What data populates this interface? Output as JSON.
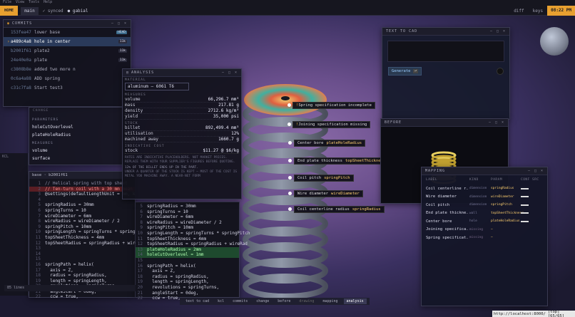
{
  "topbar": {
    "brand": "HOME",
    "branch": "main",
    "synced": "✓ synced",
    "user": "● gabial",
    "menu": [
      "File",
      "View",
      "Tools",
      "Help"
    ],
    "diff": "diff",
    "keys": "keys",
    "clock": "08:22 PM"
  },
  "commits": {
    "title": "COMMITS",
    "items": [
      {
        "hash": "153fea47",
        "msg": "lower base",
        "badge": "HEAD",
        "active": false
      },
      {
        "hash": "a489c4a8",
        "msg": "hole in center",
        "badge": "11k",
        "active": true
      },
      {
        "hash": "b2001f61",
        "msg": "plate2",
        "badge": "11k",
        "active": false
      },
      {
        "hash": "24e40e0a",
        "msg": "plate",
        "badge": "11k",
        "active": false
      },
      {
        "hash": "c3808b8e",
        "msg": "added two more n",
        "badge": "",
        "active": false
      },
      {
        "hash": "0c6a4a88",
        "msg": "ADD spring",
        "badge": "",
        "active": false
      },
      {
        "hash": "c31c7fa8",
        "msg": "Start test3",
        "badge": "",
        "active": false
      }
    ]
  },
  "params": {
    "change_label": "CHANGE",
    "parameters_label": "PARAMETERS",
    "parameters": [
      "holeCutOverlevel",
      "plateHoleRadius"
    ],
    "measures_label": "MEASURES",
    "measures": [
      "volume",
      "surface"
    ]
  },
  "analysis": {
    "title": "ANALYSIS",
    "material_label": "MATERIAL",
    "material": "aluminum — 6061 T6",
    "measures_label": "MEASURES",
    "measures": [
      {
        "k": "volume",
        "v": "66,296.7 mm³"
      },
      {
        "k": "mass",
        "v": "217.81 g"
      },
      {
        "k": "density",
        "v": "2712.6 kg/m³"
      },
      {
        "k": "yield",
        "v": "35,000 psi"
      }
    ],
    "stock_label": "STOCK",
    "stock": [
      {
        "k": "billet",
        "v": "892,499.4 mm³"
      },
      {
        "k": "utilisation",
        "v": "12%"
      },
      {
        "k": "machined away",
        "v": "1660.7 g"
      }
    ],
    "cost_label": "INDICATIVE COST",
    "cost": {
      "k": "stock",
      "v": "$11.27 @ $6/kg"
    },
    "note": "RATES ARE INDICATIVE PLACEHOLDERS. NOT MARKET PRICES. REPLACE THEM WITH YOUR SUPPLIER'S FIGURES BEFORE QUOTING.",
    "note2": "12% OF THE BILLET ENDS UP IN THE PART.",
    "note3": "UNDER A QUARTER OF THE STOCK IS KEPT — MOST OF THE COST IS METAL YOU MACHINE AWAY. A NEAR-NET FORM"
  },
  "editor_left": {
    "tab": "base · b2001f61",
    "lines": [
      "// Helical spring with top sheet",
      "// Ten-turn coil with a 30 mm mean",
      "@settings(defaultLengthUnit = mm, k",
      "",
      "springRadius = 30mm",
      "springTurns = 10",
      "wireDiameter = 6mm",
      "wireRadius = wireDiameter / 2",
      "springPitch = 10mm",
      "springLength = springTurns * springPitch",
      "topSheetThickness = 4mm",
      "topSheetRadius = springRadius + wireRad",
      "",
      "",
      "",
      "springPath = helix(",
      "  axis = Z,",
      "  radius = springRadius,",
      "  length = springLength,",
      "  revolutions = springTurns,",
      "  angleStart = 0deg,",
      "  ccw = true,"
    ],
    "status": "85 lines"
  },
  "editor_right": {
    "lines": [
      "springRadius = 30mm",
      "springTurns = 10",
      "wireDiameter = 6mm",
      "wireRadius = wireDiameter / 2",
      "springPitch = 10mm",
      "springLength = springTurns * springPitch",
      "topSheetThickness = 4mm",
      "topSheetRadius = springRadius + wireRad",
      "plateHoleRadius = 2mm",
      "holeCutOverlevel = 1mm",
      "",
      "springPath = helix(",
      "  axis = Z,",
      "  radius = springRadius,",
      "  length = springLength,",
      "  revolutions = springTurns,",
      "  angleStart = 0deg,",
      "  ccw = true,"
    ]
  },
  "sidebar_labels": {
    "kcl": "KCL"
  },
  "callouts": [
    {
      "text": "Spring specification incomplete",
      "param": "",
      "warn": true
    },
    {
      "text": "Joining specification missing",
      "param": "",
      "warn": true
    },
    {
      "text": "Center bore",
      "param": "plateHoleRadius",
      "warn": false
    },
    {
      "text": "End plate thickness",
      "param": "topSheetThickness",
      "warn": false
    },
    {
      "text": "Coil pitch",
      "param": "springPitch",
      "warn": false
    },
    {
      "text": "Wire diameter",
      "param": "wireDiameter",
      "warn": false
    },
    {
      "text": "Coil centerline radius",
      "param": "springRadius",
      "warn": false
    }
  ],
  "text_to_cad": {
    "title": "TEXT TO CAD",
    "generate": "Generate",
    "shortcut": "⏎"
  },
  "before": {
    "title": "BEFORE"
  },
  "mapping": {
    "title": "MAPPING",
    "headers": [
      "LABEL",
      "KIND",
      "PARAM",
      "CONF",
      "SRC"
    ],
    "rows": [
      {
        "label": "Coil centerline r...",
        "kind": "dimension",
        "param": "springRadius"
      },
      {
        "label": "Wire diameter",
        "kind": "dimension",
        "param": "wireDiameter"
      },
      {
        "label": "Coil pitch",
        "kind": "dimension",
        "param": "springPitch"
      },
      {
        "label": "End plate thickne...",
        "kind": "wall",
        "param": "topSheetThickness"
      },
      {
        "label": "Center bore",
        "kind": "hole",
        "param": "plateHoleRadius"
      },
      {
        "label": "Joining specifica...",
        "kind": "missing",
        "param": "—"
      },
      {
        "label": "Spring specificat...",
        "kind": "missing",
        "param": "—"
      }
    ]
  },
  "dock": {
    "items": [
      "text to cad",
      "kcl",
      "commits",
      "change",
      "before",
      "drawing",
      "mapping",
      "analysis"
    ]
  },
  "statusbar": {
    "url": "http://localhost:8000/",
    "info": "[top] [65/65]"
  },
  "colors": {
    "accent": "#e8a030",
    "warn": "#e8b040",
    "param": "#ffd070",
    "selection": "#2a3a5a"
  }
}
